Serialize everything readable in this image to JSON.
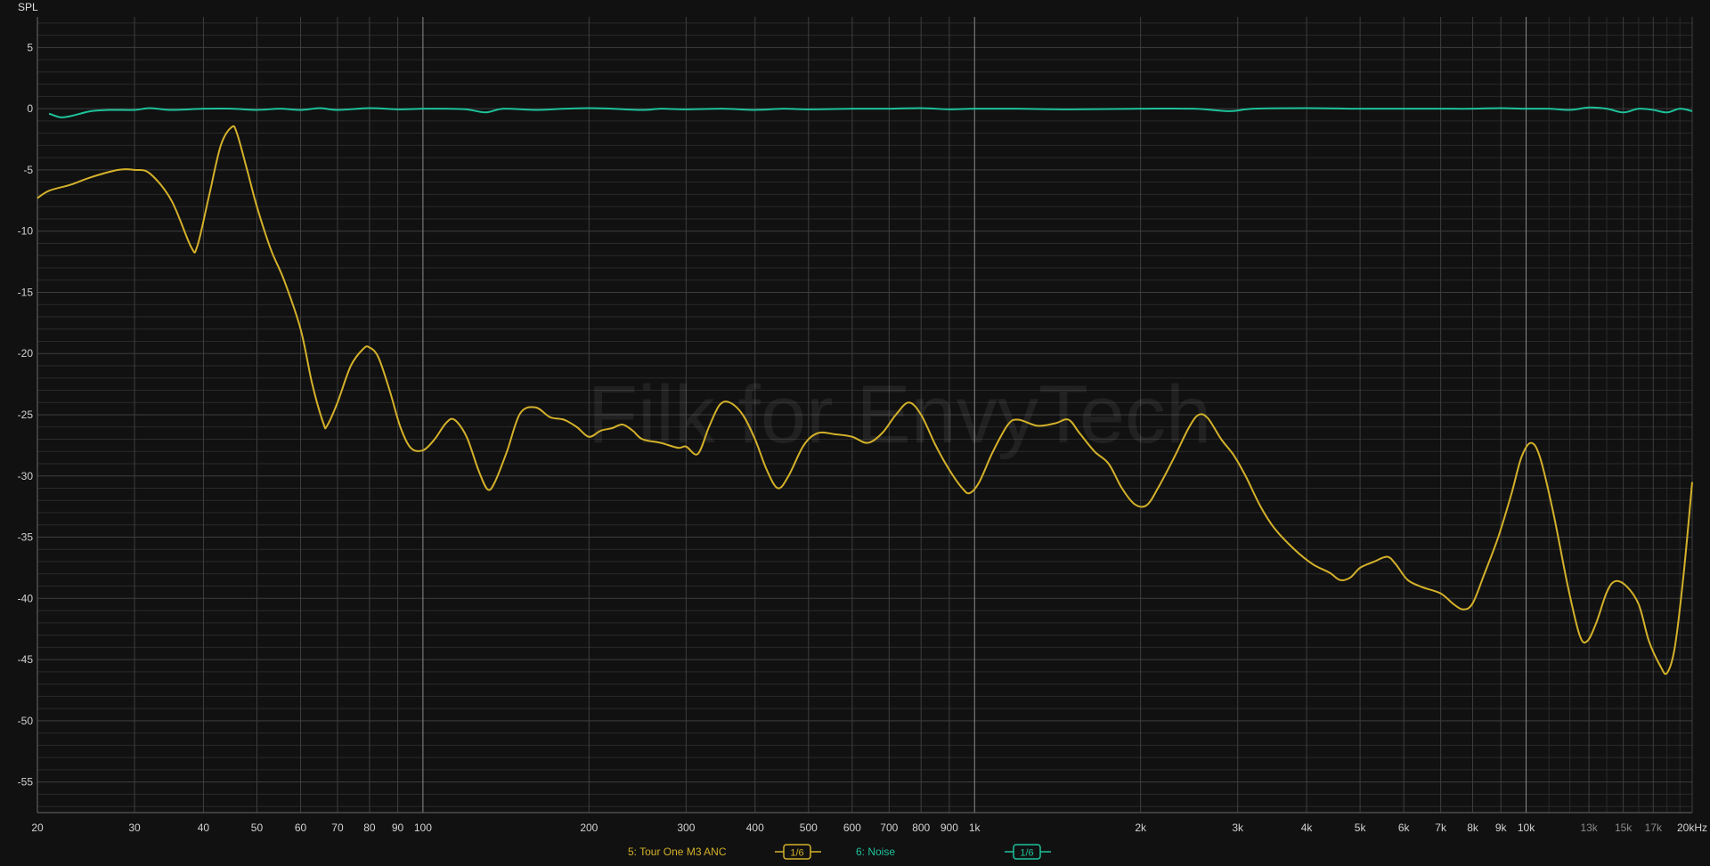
{
  "chart_data": {
    "type": "line",
    "ylabel": "SPL",
    "watermark": "Filk for EnvyTech",
    "x_scale": "log",
    "xlim": [
      20,
      20000
    ],
    "ylim": [
      -57.5,
      7.5
    ],
    "y_ticks": [
      5,
      0,
      -5,
      -10,
      -15,
      -20,
      -25,
      -30,
      -35,
      -40,
      -45,
      -50,
      -55
    ],
    "x_ticks": [
      {
        "value": 20,
        "label": "20"
      },
      {
        "value": 30,
        "label": "30"
      },
      {
        "value": 40,
        "label": "40"
      },
      {
        "value": 50,
        "label": "50"
      },
      {
        "value": 60,
        "label": "60"
      },
      {
        "value": 70,
        "label": "70"
      },
      {
        "value": 80,
        "label": "80"
      },
      {
        "value": 90,
        "label": "90"
      },
      {
        "value": 100,
        "label": "100"
      },
      {
        "value": 200,
        "label": "200"
      },
      {
        "value": 300,
        "label": "300"
      },
      {
        "value": 400,
        "label": "400"
      },
      {
        "value": 500,
        "label": "500"
      },
      {
        "value": 600,
        "label": "600"
      },
      {
        "value": 700,
        "label": "700"
      },
      {
        "value": 800,
        "label": "800"
      },
      {
        "value": 900,
        "label": "900"
      },
      {
        "value": 1000,
        "label": "1k"
      },
      {
        "value": 2000,
        "label": "2k"
      },
      {
        "value": 3000,
        "label": "3k"
      },
      {
        "value": 4000,
        "label": "4k"
      },
      {
        "value": 5000,
        "label": "5k"
      },
      {
        "value": 6000,
        "label": "6k"
      },
      {
        "value": 7000,
        "label": "7k"
      },
      {
        "value": 8000,
        "label": "8k"
      },
      {
        "value": 9000,
        "label": "9k"
      },
      {
        "value": 10000,
        "label": "10k"
      },
      {
        "value": 13000,
        "label": "13k",
        "dim": true
      },
      {
        "value": 15000,
        "label": "15k",
        "dim": true
      },
      {
        "value": 17000,
        "label": "17k",
        "dim": true
      },
      {
        "value": 20000,
        "label": "20kHz"
      }
    ],
    "grid": true,
    "legend_position": "bottom-center",
    "series": [
      {
        "name": "5: Tour One M3 ANC",
        "smoothing": "1/6",
        "color": "#d4b12a",
        "points": [
          [
            20,
            -7.3
          ],
          [
            21,
            -6.7
          ],
          [
            23,
            -6.2
          ],
          [
            25,
            -5.6
          ],
          [
            28,
            -5.0
          ],
          [
            30,
            -5.0
          ],
          [
            32,
            -5.3
          ],
          [
            35,
            -7.5
          ],
          [
            38,
            -11.3
          ],
          [
            39,
            -11.2
          ],
          [
            41,
            -7.0
          ],
          [
            43,
            -3.0
          ],
          [
            45,
            -1.5
          ],
          [
            46,
            -2.0
          ],
          [
            48,
            -5.0
          ],
          [
            50,
            -8.0
          ],
          [
            53,
            -11.5
          ],
          [
            56,
            -14.0
          ],
          [
            60,
            -18.0
          ],
          [
            63,
            -22.5
          ],
          [
            66,
            -25.7
          ],
          [
            67,
            -25.9
          ],
          [
            70,
            -24.0
          ],
          [
            74,
            -21.0
          ],
          [
            78,
            -19.6
          ],
          [
            80,
            -19.5
          ],
          [
            83,
            -20.3
          ],
          [
            87,
            -23.0
          ],
          [
            91,
            -26.0
          ],
          [
            95,
            -27.7
          ],
          [
            100,
            -27.9
          ],
          [
            105,
            -27.0
          ],
          [
            110,
            -25.7
          ],
          [
            114,
            -25.4
          ],
          [
            120,
            -26.8
          ],
          [
            126,
            -29.5
          ],
          [
            131,
            -31.1
          ],
          [
            135,
            -30.5
          ],
          [
            142,
            -28.0
          ],
          [
            150,
            -24.9
          ],
          [
            160,
            -24.4
          ],
          [
            170,
            -25.2
          ],
          [
            180,
            -25.4
          ],
          [
            190,
            -26.0
          ],
          [
            200,
            -26.8
          ],
          [
            210,
            -26.3
          ],
          [
            220,
            -26.1
          ],
          [
            230,
            -25.8
          ],
          [
            240,
            -26.3
          ],
          [
            250,
            -27.0
          ],
          [
            270,
            -27.3
          ],
          [
            290,
            -27.7
          ],
          [
            300,
            -27.6
          ],
          [
            315,
            -28.2
          ],
          [
            330,
            -26.0
          ],
          [
            345,
            -24.2
          ],
          [
            360,
            -24.0
          ],
          [
            380,
            -25.0
          ],
          [
            400,
            -27.0
          ],
          [
            420,
            -29.5
          ],
          [
            440,
            -31.0
          ],
          [
            460,
            -30.0
          ],
          [
            490,
            -27.5
          ],
          [
            520,
            -26.5
          ],
          [
            560,
            -26.6
          ],
          [
            600,
            -26.8
          ],
          [
            640,
            -27.3
          ],
          [
            680,
            -26.5
          ],
          [
            720,
            -25.0
          ],
          [
            760,
            -24.0
          ],
          [
            800,
            -25.0
          ],
          [
            850,
            -27.5
          ],
          [
            900,
            -29.5
          ],
          [
            950,
            -31.0
          ],
          [
            980,
            -31.4
          ],
          [
            1020,
            -30.5
          ],
          [
            1080,
            -28.0
          ],
          [
            1150,
            -25.8
          ],
          [
            1200,
            -25.4
          ],
          [
            1300,
            -25.9
          ],
          [
            1400,
            -25.7
          ],
          [
            1480,
            -25.4
          ],
          [
            1550,
            -26.5
          ],
          [
            1650,
            -28.0
          ],
          [
            1750,
            -29.0
          ],
          [
            1850,
            -31.0
          ],
          [
            1950,
            -32.3
          ],
          [
            2050,
            -32.4
          ],
          [
            2150,
            -31.0
          ],
          [
            2300,
            -28.5
          ],
          [
            2450,
            -26.0
          ],
          [
            2550,
            -25.0
          ],
          [
            2650,
            -25.3
          ],
          [
            2800,
            -27.0
          ],
          [
            2950,
            -28.3
          ],
          [
            3100,
            -30.0
          ],
          [
            3300,
            -32.5
          ],
          [
            3500,
            -34.3
          ],
          [
            3800,
            -36.0
          ],
          [
            4100,
            -37.2
          ],
          [
            4400,
            -37.9
          ],
          [
            4600,
            -38.5
          ],
          [
            4800,
            -38.3
          ],
          [
            5000,
            -37.5
          ],
          [
            5300,
            -37.0
          ],
          [
            5600,
            -36.6
          ],
          [
            5800,
            -37.2
          ],
          [
            6100,
            -38.5
          ],
          [
            6500,
            -39.1
          ],
          [
            7000,
            -39.6
          ],
          [
            7400,
            -40.5
          ],
          [
            7700,
            -40.9
          ],
          [
            8000,
            -40.4
          ],
          [
            8400,
            -38.0
          ],
          [
            8900,
            -35.0
          ],
          [
            9400,
            -31.5
          ],
          [
            9800,
            -28.5
          ],
          [
            10200,
            -27.3
          ],
          [
            10600,
            -28.5
          ],
          [
            11200,
            -33.0
          ],
          [
            11900,
            -39.0
          ],
          [
            12500,
            -43.0
          ],
          [
            12900,
            -43.5
          ],
          [
            13400,
            -42.0
          ],
          [
            14000,
            -39.5
          ],
          [
            14500,
            -38.6
          ],
          [
            15200,
            -39.0
          ],
          [
            16000,
            -40.5
          ],
          [
            16700,
            -43.5
          ],
          [
            17500,
            -45.5
          ],
          [
            18000,
            -46.1
          ],
          [
            18600,
            -44.0
          ],
          [
            19300,
            -38.0
          ],
          [
            20000,
            -30.5
          ]
        ]
      },
      {
        "name": "6: Noise",
        "smoothing": "1/6",
        "color": "#1ec29a",
        "points": [
          [
            21,
            -0.4
          ],
          [
            22,
            -0.7
          ],
          [
            23,
            -0.6
          ],
          [
            25,
            -0.2
          ],
          [
            27,
            -0.1
          ],
          [
            30,
            -0.1
          ],
          [
            32,
            0.05
          ],
          [
            35,
            -0.1
          ],
          [
            40,
            0.0
          ],
          [
            45,
            0.0
          ],
          [
            50,
            -0.1
          ],
          [
            55,
            0.0
          ],
          [
            60,
            -0.1
          ],
          [
            65,
            0.05
          ],
          [
            70,
            -0.1
          ],
          [
            80,
            0.05
          ],
          [
            90,
            -0.05
          ],
          [
            100,
            0.0
          ],
          [
            110,
            0.0
          ],
          [
            120,
            -0.05
          ],
          [
            130,
            -0.3
          ],
          [
            140,
            0.0
          ],
          [
            160,
            -0.1
          ],
          [
            180,
            0.0
          ],
          [
            200,
            0.05
          ],
          [
            220,
            0.0
          ],
          [
            250,
            -0.1
          ],
          [
            270,
            0.0
          ],
          [
            300,
            -0.05
          ],
          [
            350,
            0.0
          ],
          [
            400,
            -0.1
          ],
          [
            450,
            0.0
          ],
          [
            500,
            -0.05
          ],
          [
            600,
            0.0
          ],
          [
            700,
            0.0
          ],
          [
            800,
            0.05
          ],
          [
            900,
            -0.05
          ],
          [
            1000,
            0.0
          ],
          [
            1200,
            0.0
          ],
          [
            1500,
            -0.05
          ],
          [
            2000,
            0.0
          ],
          [
            2500,
            0.0
          ],
          [
            2900,
            -0.2
          ],
          [
            3200,
            0.0
          ],
          [
            4000,
            0.05
          ],
          [
            5000,
            0.0
          ],
          [
            6000,
            0.0
          ],
          [
            7000,
            0.0
          ],
          [
            8000,
            0.0
          ],
          [
            9000,
            0.05
          ],
          [
            10000,
            0.0
          ],
          [
            11000,
            0.0
          ],
          [
            12000,
            -0.1
          ],
          [
            13000,
            0.1
          ],
          [
            14000,
            0.0
          ],
          [
            15000,
            -0.3
          ],
          [
            16000,
            0.0
          ],
          [
            17000,
            -0.1
          ],
          [
            18000,
            -0.3
          ],
          [
            19000,
            0.0
          ],
          [
            20000,
            -0.2
          ]
        ]
      }
    ]
  }
}
